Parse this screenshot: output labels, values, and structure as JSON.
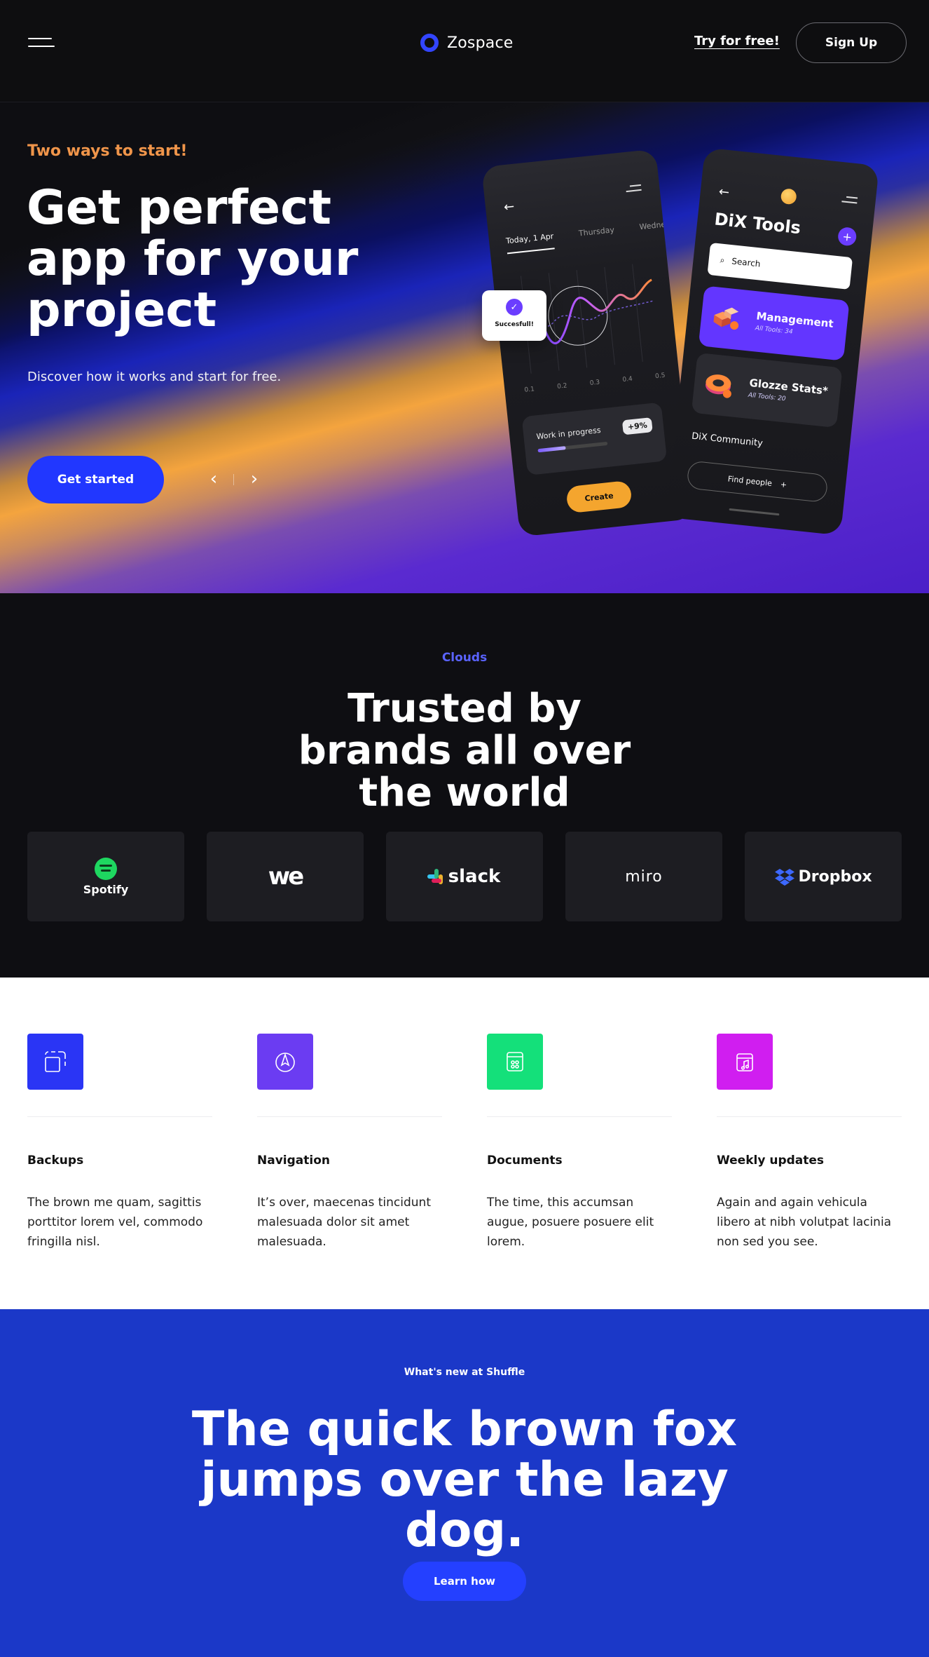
{
  "nav": {
    "brand": "Zospace",
    "try_label": "Try for free!",
    "signup_label": "Sign Up",
    "brand_color": "#3245ff"
  },
  "hero": {
    "eyebrow": "Two ways to start!",
    "title": "Get perfect app for your project",
    "subtitle": "Discover how it works and start for free.",
    "cta_label": "Get started",
    "prev_icon": "chevron-left-icon",
    "next_icon": "chevron-right-icon",
    "accent_color": "#2137ff",
    "eyebrow_color": "#f0954a"
  },
  "phone_left": {
    "tabs": [
      "Today, 1 Apr",
      "Thursday",
      "Wednesday"
    ],
    "ticks": [
      "0.1",
      "0.2",
      "0.3",
      "0.4",
      "0.5"
    ],
    "progress_label": "Work in progress",
    "progress_badge": "+9%",
    "progress_value": 0.4,
    "create_label": "Create"
  },
  "toast": {
    "text": "Succesfull!"
  },
  "phone_right": {
    "title": "DiX Tools",
    "search_placeholder": "Search",
    "card1_title": "Management",
    "card1_sub": "All Tools: 34",
    "card2_title": "Glozze Stats*",
    "card2_sub": "All Tools: 20",
    "community": "DiX Community",
    "find_label": "Find people"
  },
  "brands": {
    "eyebrow": "Clouds",
    "title": "Trusted by brands all over the world",
    "logos": [
      "Spotify",
      "we",
      "slack",
      "miro",
      "Dropbox"
    ],
    "eyebrow_color": "#5a63ff"
  },
  "features": [
    {
      "title": "Backups",
      "text": "The brown me quam, sagittis porttitor lorem vel, commodo fringilla nisl.",
      "icon": "backup-icon",
      "color": "#2a35f5"
    },
    {
      "title": "Navigation",
      "text": "It’s over, maecenas tincidunt malesuada dolor sit amet malesuada.",
      "icon": "compass-icon",
      "color": "#6b3cf2"
    },
    {
      "title": "Documents",
      "text": "The time, this accumsan augue, posuere posuere elit lorem.",
      "icon": "document-icon",
      "color": "#14e07a"
    },
    {
      "title": "Weekly updates",
      "text": "Again and again vehicula libero at nibh volutpat lacinia non sed you see.",
      "icon": "music-calendar-icon",
      "color": "#d01ef0"
    }
  ],
  "news": {
    "eyebrow": "What's new at Shuffle",
    "title": "The quick brown fox jumps over the lazy dog.",
    "button_label": "Learn how",
    "background": "#1b38c8"
  }
}
